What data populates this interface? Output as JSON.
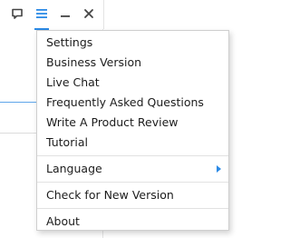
{
  "titlebar": {
    "icons": [
      "feedback-icon",
      "menu-icon",
      "minimize-icon",
      "close-icon"
    ]
  },
  "menu": {
    "items": [
      {
        "label": "Settings"
      },
      {
        "label": "Business Version"
      },
      {
        "label": "Live Chat"
      },
      {
        "label": "Frequently Asked Questions"
      },
      {
        "label": "Write A Product Review"
      },
      {
        "label": "Tutorial"
      },
      {
        "label": "Language",
        "has_submenu": true
      },
      {
        "label": "Check for New Version"
      },
      {
        "label": "About"
      }
    ]
  },
  "colors": {
    "accent": "#2b8ae6",
    "icon": "#444444"
  }
}
